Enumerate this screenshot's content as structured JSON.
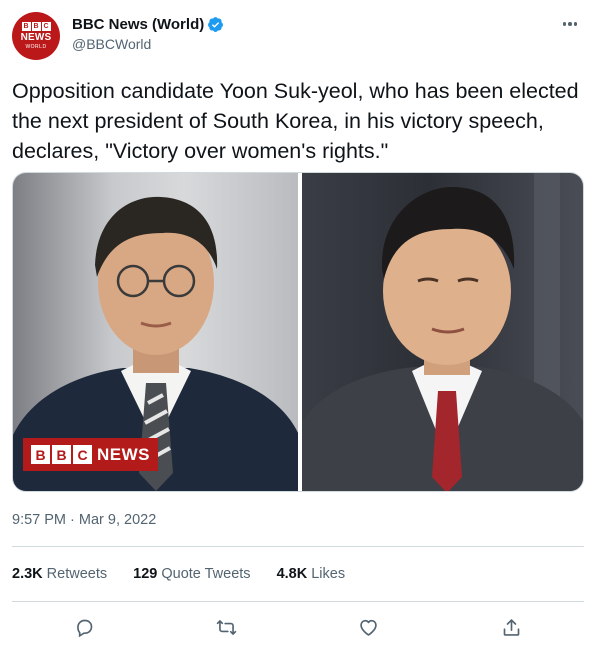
{
  "account": {
    "avatar_lines": {
      "letters": [
        "B",
        "B",
        "C"
      ],
      "news": "NEWS",
      "world": "WORLD"
    },
    "display_name": "BBC News (World)",
    "handle": "@BBCWorld",
    "verified": true
  },
  "tweet": {
    "text": "Opposition candidate Yoon Suk-yeol, who has been elected the next president of South Korea, in his victory speech, declares, \"Victory over women's rights.\"",
    "timestamp": "9:57 PM · Mar 9, 2022"
  },
  "media": {
    "watermark_letters": [
      "B",
      "B",
      "C"
    ],
    "watermark_news": "NEWS"
  },
  "stats": {
    "retweets_count": "2.3K",
    "retweets_label": "Retweets",
    "quotes_count": "129",
    "quotes_label": "Quote Tweets",
    "likes_count": "4.8K",
    "likes_label": "Likes"
  },
  "icons": {
    "more": "more-icon",
    "reply": "reply-icon",
    "retweet": "retweet-icon",
    "like": "like-icon",
    "share": "share-icon",
    "verified": "verified-badge-icon"
  },
  "colors": {
    "brand_red": "#bb1919",
    "verified_blue": "#1d9bf0",
    "text": "#0f1419",
    "secondary_text": "#536471",
    "divider": "#cfd9de"
  }
}
